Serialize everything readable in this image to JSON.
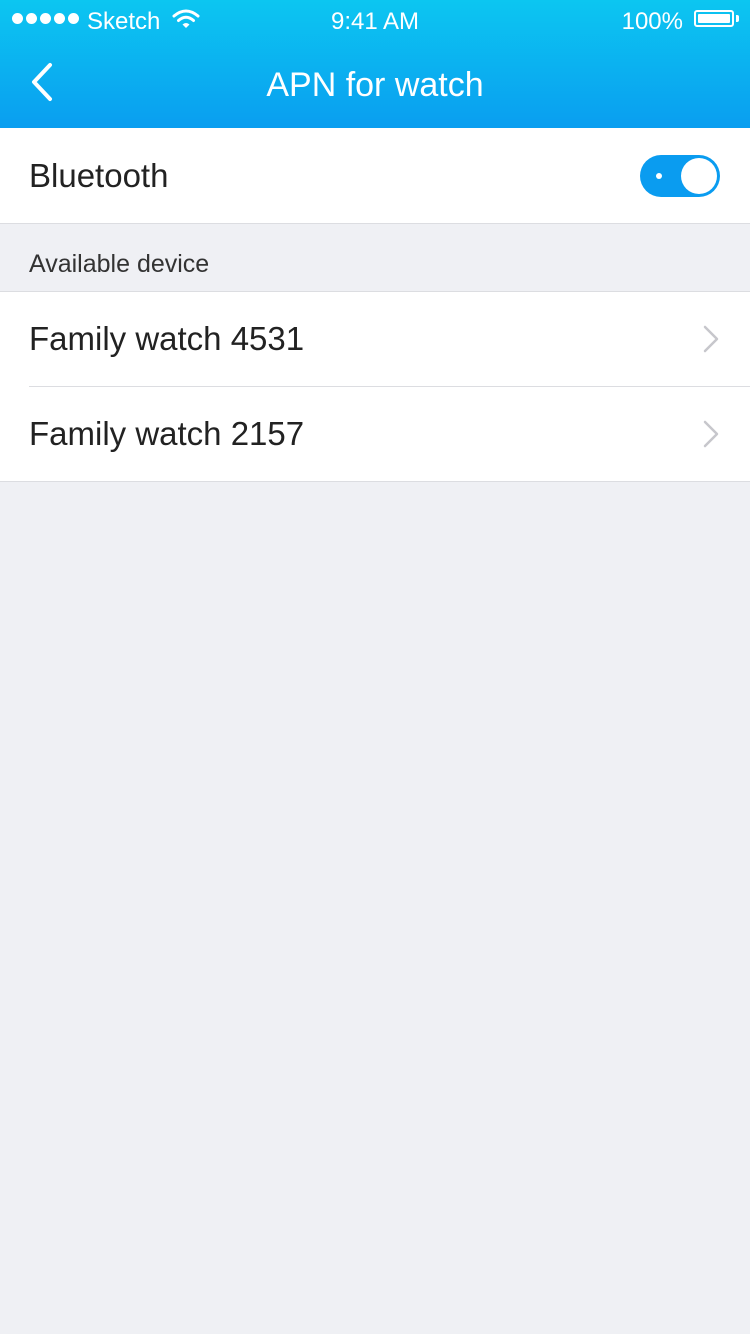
{
  "status_bar": {
    "carrier": "Sketch",
    "time": "9:41 AM",
    "battery": "100%",
    "signal_icon": "signal-dots-icon",
    "wifi_icon": "wifi-icon",
    "battery_icon": "battery-icon"
  },
  "nav": {
    "back_icon": "chevron-left-icon",
    "title": "APN for watch"
  },
  "bluetooth": {
    "label": "Bluetooth",
    "enabled": true
  },
  "devices": {
    "section_title": "Available device",
    "items": [
      {
        "label": "Family watch 4531"
      },
      {
        "label": "Family watch 2157"
      }
    ]
  },
  "colors": {
    "accent": "#0a9cf0",
    "header_top": "#0cc6f1",
    "header_bottom": "#0a9ef0",
    "background": "#eff0f4",
    "divider": "#dcdde1"
  }
}
